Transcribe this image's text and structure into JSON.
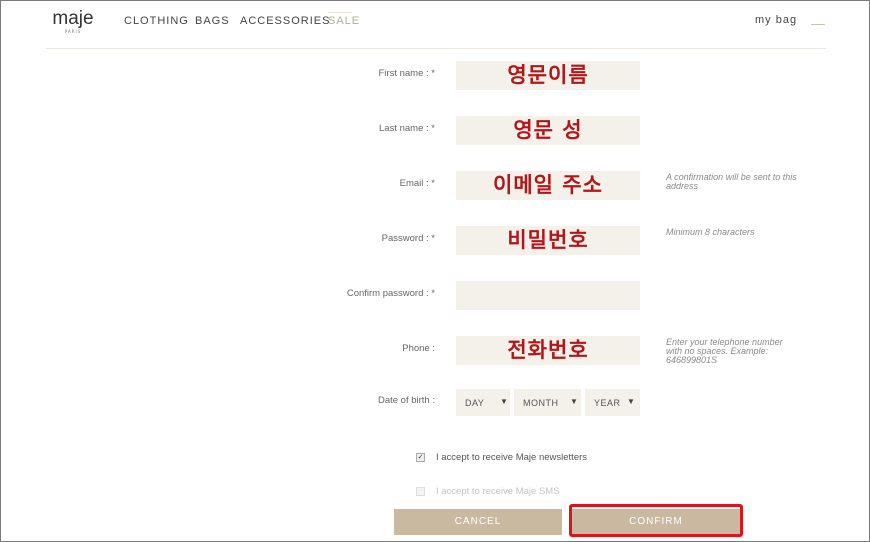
{
  "header": {
    "logo": "maje",
    "logo_sub": "PARIS",
    "nav": [
      "CLOTHING",
      "BAGS",
      "ACCESSORIES",
      "SALE"
    ],
    "my_bag": "my bag"
  },
  "form": {
    "first_name": {
      "label": "First name : *",
      "annotation": "영문이름"
    },
    "last_name": {
      "label": "Last name : *",
      "annotation": "영문 성"
    },
    "email": {
      "label": "Email : *",
      "annotation": "이메일 주소",
      "hint": "A confirmation will be sent to this address"
    },
    "password": {
      "label": "Password : *",
      "annotation": "비밀번호",
      "hint": "Minimum 8 characters"
    },
    "confirm_password": {
      "label": "Confirm password : *"
    },
    "phone": {
      "label": "Phone :",
      "annotation": "전화번호",
      "hint": "Enter your telephone number with no spaces. Example: 646899801S"
    },
    "dob": {
      "label": "Date of birth :",
      "day": "DAY",
      "month": "MONTH",
      "year": "YEAR"
    },
    "newsletter": {
      "label": "I accept to receive Maje newsletters",
      "checked": true
    },
    "sms": {
      "label": "I accept to receive Maje SMS",
      "checked": false
    },
    "cancel_label": "CANCEL",
    "confirm_label": "CONFIRM"
  },
  "colors": {
    "field_bg": "#f4f1ea",
    "button_bg": "#c8b9a0",
    "annotation_red": "#b2161a",
    "highlight_border": "#e0121b"
  }
}
